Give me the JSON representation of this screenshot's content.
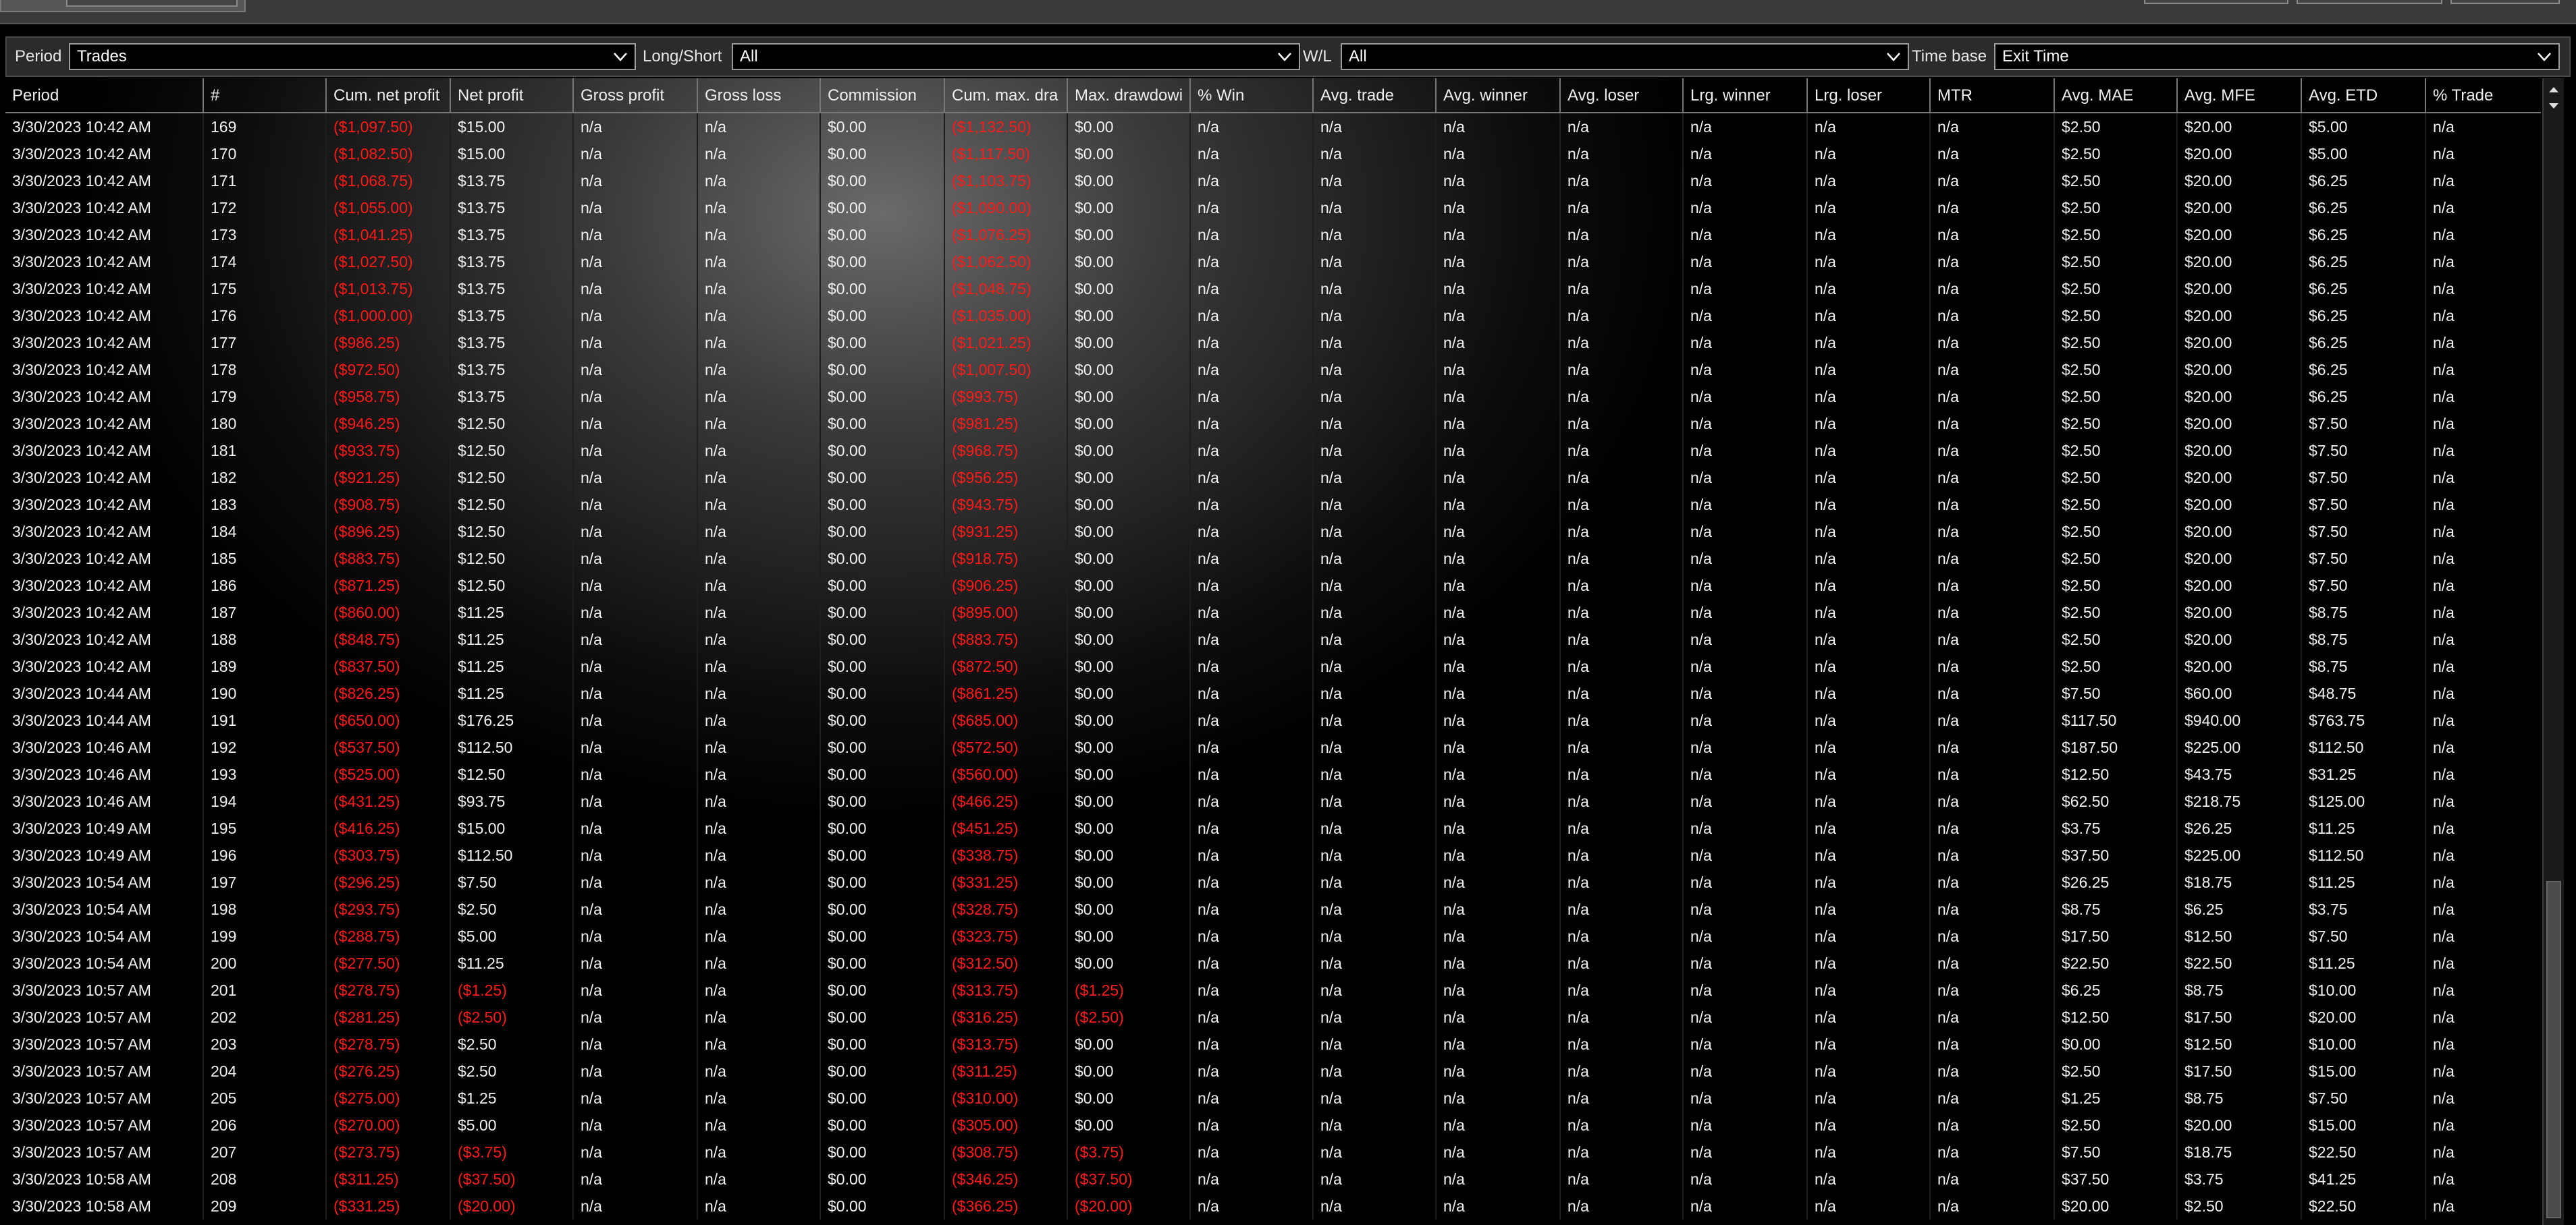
{
  "colors": {
    "negative": "#ff1a1a",
    "text": "#f2f2f2",
    "background": "#000000"
  },
  "filters": {
    "period_label": "Period",
    "period_value": "Trades",
    "longshort_label": "Long/Short",
    "longshort_value": "All",
    "wl_label": "W/L",
    "wl_value": "All",
    "timebase_label": "Time base",
    "timebase_value": "Exit Time"
  },
  "columns": [
    "Period",
    "#",
    "Cum. net profit",
    "Net profit",
    "Gross profit",
    "Gross loss",
    "Commission",
    "Cum. max. dra",
    "Max. drawdowi",
    "% Win",
    "Avg. trade",
    "Avg. winner",
    "Avg. loser",
    "Lrg. winner",
    "Lrg. loser",
    "MTR",
    "Avg. MAE",
    "Avg. MFE",
    "Avg. ETD",
    "% Trade"
  ],
  "rows": [
    [
      "3/30/2023 10:42 AM",
      "169",
      "($1,097.50)",
      "$15.00",
      "n/a",
      "n/a",
      "$0.00",
      "($1,132.50)",
      "$0.00",
      "n/a",
      "n/a",
      "n/a",
      "n/a",
      "n/a",
      "n/a",
      "n/a",
      "$2.50",
      "$20.00",
      "$5.00",
      "n/a"
    ],
    [
      "3/30/2023 10:42 AM",
      "170",
      "($1,082.50)",
      "$15.00",
      "n/a",
      "n/a",
      "$0.00",
      "($1,117.50)",
      "$0.00",
      "n/a",
      "n/a",
      "n/a",
      "n/a",
      "n/a",
      "n/a",
      "n/a",
      "$2.50",
      "$20.00",
      "$5.00",
      "n/a"
    ],
    [
      "3/30/2023 10:42 AM",
      "171",
      "($1,068.75)",
      "$13.75",
      "n/a",
      "n/a",
      "$0.00",
      "($1,103.75)",
      "$0.00",
      "n/a",
      "n/a",
      "n/a",
      "n/a",
      "n/a",
      "n/a",
      "n/a",
      "$2.50",
      "$20.00",
      "$6.25",
      "n/a"
    ],
    [
      "3/30/2023 10:42 AM",
      "172",
      "($1,055.00)",
      "$13.75",
      "n/a",
      "n/a",
      "$0.00",
      "($1,090.00)",
      "$0.00",
      "n/a",
      "n/a",
      "n/a",
      "n/a",
      "n/a",
      "n/a",
      "n/a",
      "$2.50",
      "$20.00",
      "$6.25",
      "n/a"
    ],
    [
      "3/30/2023 10:42 AM",
      "173",
      "($1,041.25)",
      "$13.75",
      "n/a",
      "n/a",
      "$0.00",
      "($1,076.25)",
      "$0.00",
      "n/a",
      "n/a",
      "n/a",
      "n/a",
      "n/a",
      "n/a",
      "n/a",
      "$2.50",
      "$20.00",
      "$6.25",
      "n/a"
    ],
    [
      "3/30/2023 10:42 AM",
      "174",
      "($1,027.50)",
      "$13.75",
      "n/a",
      "n/a",
      "$0.00",
      "($1,062.50)",
      "$0.00",
      "n/a",
      "n/a",
      "n/a",
      "n/a",
      "n/a",
      "n/a",
      "n/a",
      "$2.50",
      "$20.00",
      "$6.25",
      "n/a"
    ],
    [
      "3/30/2023 10:42 AM",
      "175",
      "($1,013.75)",
      "$13.75",
      "n/a",
      "n/a",
      "$0.00",
      "($1,048.75)",
      "$0.00",
      "n/a",
      "n/a",
      "n/a",
      "n/a",
      "n/a",
      "n/a",
      "n/a",
      "$2.50",
      "$20.00",
      "$6.25",
      "n/a"
    ],
    [
      "3/30/2023 10:42 AM",
      "176",
      "($1,000.00)",
      "$13.75",
      "n/a",
      "n/a",
      "$0.00",
      "($1,035.00)",
      "$0.00",
      "n/a",
      "n/a",
      "n/a",
      "n/a",
      "n/a",
      "n/a",
      "n/a",
      "$2.50",
      "$20.00",
      "$6.25",
      "n/a"
    ],
    [
      "3/30/2023 10:42 AM",
      "177",
      "($986.25)",
      "$13.75",
      "n/a",
      "n/a",
      "$0.00",
      "($1,021.25)",
      "$0.00",
      "n/a",
      "n/a",
      "n/a",
      "n/a",
      "n/a",
      "n/a",
      "n/a",
      "$2.50",
      "$20.00",
      "$6.25",
      "n/a"
    ],
    [
      "3/30/2023 10:42 AM",
      "178",
      "($972.50)",
      "$13.75",
      "n/a",
      "n/a",
      "$0.00",
      "($1,007.50)",
      "$0.00",
      "n/a",
      "n/a",
      "n/a",
      "n/a",
      "n/a",
      "n/a",
      "n/a",
      "$2.50",
      "$20.00",
      "$6.25",
      "n/a"
    ],
    [
      "3/30/2023 10:42 AM",
      "179",
      "($958.75)",
      "$13.75",
      "n/a",
      "n/a",
      "$0.00",
      "($993.75)",
      "$0.00",
      "n/a",
      "n/a",
      "n/a",
      "n/a",
      "n/a",
      "n/a",
      "n/a",
      "$2.50",
      "$20.00",
      "$6.25",
      "n/a"
    ],
    [
      "3/30/2023 10:42 AM",
      "180",
      "($946.25)",
      "$12.50",
      "n/a",
      "n/a",
      "$0.00",
      "($981.25)",
      "$0.00",
      "n/a",
      "n/a",
      "n/a",
      "n/a",
      "n/a",
      "n/a",
      "n/a",
      "$2.50",
      "$20.00",
      "$7.50",
      "n/a"
    ],
    [
      "3/30/2023 10:42 AM",
      "181",
      "($933.75)",
      "$12.50",
      "n/a",
      "n/a",
      "$0.00",
      "($968.75)",
      "$0.00",
      "n/a",
      "n/a",
      "n/a",
      "n/a",
      "n/a",
      "n/a",
      "n/a",
      "$2.50",
      "$20.00",
      "$7.50",
      "n/a"
    ],
    [
      "3/30/2023 10:42 AM",
      "182",
      "($921.25)",
      "$12.50",
      "n/a",
      "n/a",
      "$0.00",
      "($956.25)",
      "$0.00",
      "n/a",
      "n/a",
      "n/a",
      "n/a",
      "n/a",
      "n/a",
      "n/a",
      "$2.50",
      "$20.00",
      "$7.50",
      "n/a"
    ],
    [
      "3/30/2023 10:42 AM",
      "183",
      "($908.75)",
      "$12.50",
      "n/a",
      "n/a",
      "$0.00",
      "($943.75)",
      "$0.00",
      "n/a",
      "n/a",
      "n/a",
      "n/a",
      "n/a",
      "n/a",
      "n/a",
      "$2.50",
      "$20.00",
      "$7.50",
      "n/a"
    ],
    [
      "3/30/2023 10:42 AM",
      "184",
      "($896.25)",
      "$12.50",
      "n/a",
      "n/a",
      "$0.00",
      "($931.25)",
      "$0.00",
      "n/a",
      "n/a",
      "n/a",
      "n/a",
      "n/a",
      "n/a",
      "n/a",
      "$2.50",
      "$20.00",
      "$7.50",
      "n/a"
    ],
    [
      "3/30/2023 10:42 AM",
      "185",
      "($883.75)",
      "$12.50",
      "n/a",
      "n/a",
      "$0.00",
      "($918.75)",
      "$0.00",
      "n/a",
      "n/a",
      "n/a",
      "n/a",
      "n/a",
      "n/a",
      "n/a",
      "$2.50",
      "$20.00",
      "$7.50",
      "n/a"
    ],
    [
      "3/30/2023 10:42 AM",
      "186",
      "($871.25)",
      "$12.50",
      "n/a",
      "n/a",
      "$0.00",
      "($906.25)",
      "$0.00",
      "n/a",
      "n/a",
      "n/a",
      "n/a",
      "n/a",
      "n/a",
      "n/a",
      "$2.50",
      "$20.00",
      "$7.50",
      "n/a"
    ],
    [
      "3/30/2023 10:42 AM",
      "187",
      "($860.00)",
      "$11.25",
      "n/a",
      "n/a",
      "$0.00",
      "($895.00)",
      "$0.00",
      "n/a",
      "n/a",
      "n/a",
      "n/a",
      "n/a",
      "n/a",
      "n/a",
      "$2.50",
      "$20.00",
      "$8.75",
      "n/a"
    ],
    [
      "3/30/2023 10:42 AM",
      "188",
      "($848.75)",
      "$11.25",
      "n/a",
      "n/a",
      "$0.00",
      "($883.75)",
      "$0.00",
      "n/a",
      "n/a",
      "n/a",
      "n/a",
      "n/a",
      "n/a",
      "n/a",
      "$2.50",
      "$20.00",
      "$8.75",
      "n/a"
    ],
    [
      "3/30/2023 10:42 AM",
      "189",
      "($837.50)",
      "$11.25",
      "n/a",
      "n/a",
      "$0.00",
      "($872.50)",
      "$0.00",
      "n/a",
      "n/a",
      "n/a",
      "n/a",
      "n/a",
      "n/a",
      "n/a",
      "$2.50",
      "$20.00",
      "$8.75",
      "n/a"
    ],
    [
      "3/30/2023 10:44 AM",
      "190",
      "($826.25)",
      "$11.25",
      "n/a",
      "n/a",
      "$0.00",
      "($861.25)",
      "$0.00",
      "n/a",
      "n/a",
      "n/a",
      "n/a",
      "n/a",
      "n/a",
      "n/a",
      "$7.50",
      "$60.00",
      "$48.75",
      "n/a"
    ],
    [
      "3/30/2023 10:44 AM",
      "191",
      "($650.00)",
      "$176.25",
      "n/a",
      "n/a",
      "$0.00",
      "($685.00)",
      "$0.00",
      "n/a",
      "n/a",
      "n/a",
      "n/a",
      "n/a",
      "n/a",
      "n/a",
      "$117.50",
      "$940.00",
      "$763.75",
      "n/a"
    ],
    [
      "3/30/2023 10:46 AM",
      "192",
      "($537.50)",
      "$112.50",
      "n/a",
      "n/a",
      "$0.00",
      "($572.50)",
      "$0.00",
      "n/a",
      "n/a",
      "n/a",
      "n/a",
      "n/a",
      "n/a",
      "n/a",
      "$187.50",
      "$225.00",
      "$112.50",
      "n/a"
    ],
    [
      "3/30/2023 10:46 AM",
      "193",
      "($525.00)",
      "$12.50",
      "n/a",
      "n/a",
      "$0.00",
      "($560.00)",
      "$0.00",
      "n/a",
      "n/a",
      "n/a",
      "n/a",
      "n/a",
      "n/a",
      "n/a",
      "$12.50",
      "$43.75",
      "$31.25",
      "n/a"
    ],
    [
      "3/30/2023 10:46 AM",
      "194",
      "($431.25)",
      "$93.75",
      "n/a",
      "n/a",
      "$0.00",
      "($466.25)",
      "$0.00",
      "n/a",
      "n/a",
      "n/a",
      "n/a",
      "n/a",
      "n/a",
      "n/a",
      "$62.50",
      "$218.75",
      "$125.00",
      "n/a"
    ],
    [
      "3/30/2023 10:49 AM",
      "195",
      "($416.25)",
      "$15.00",
      "n/a",
      "n/a",
      "$0.00",
      "($451.25)",
      "$0.00",
      "n/a",
      "n/a",
      "n/a",
      "n/a",
      "n/a",
      "n/a",
      "n/a",
      "$3.75",
      "$26.25",
      "$11.25",
      "n/a"
    ],
    [
      "3/30/2023 10:49 AM",
      "196",
      "($303.75)",
      "$112.50",
      "n/a",
      "n/a",
      "$0.00",
      "($338.75)",
      "$0.00",
      "n/a",
      "n/a",
      "n/a",
      "n/a",
      "n/a",
      "n/a",
      "n/a",
      "$37.50",
      "$225.00",
      "$112.50",
      "n/a"
    ],
    [
      "3/30/2023 10:54 AM",
      "197",
      "($296.25)",
      "$7.50",
      "n/a",
      "n/a",
      "$0.00",
      "($331.25)",
      "$0.00",
      "n/a",
      "n/a",
      "n/a",
      "n/a",
      "n/a",
      "n/a",
      "n/a",
      "$26.25",
      "$18.75",
      "$11.25",
      "n/a"
    ],
    [
      "3/30/2023 10:54 AM",
      "198",
      "($293.75)",
      "$2.50",
      "n/a",
      "n/a",
      "$0.00",
      "($328.75)",
      "$0.00",
      "n/a",
      "n/a",
      "n/a",
      "n/a",
      "n/a",
      "n/a",
      "n/a",
      "$8.75",
      "$6.25",
      "$3.75",
      "n/a"
    ],
    [
      "3/30/2023 10:54 AM",
      "199",
      "($288.75)",
      "$5.00",
      "n/a",
      "n/a",
      "$0.00",
      "($323.75)",
      "$0.00",
      "n/a",
      "n/a",
      "n/a",
      "n/a",
      "n/a",
      "n/a",
      "n/a",
      "$17.50",
      "$12.50",
      "$7.50",
      "n/a"
    ],
    [
      "3/30/2023 10:54 AM",
      "200",
      "($277.50)",
      "$11.25",
      "n/a",
      "n/a",
      "$0.00",
      "($312.50)",
      "$0.00",
      "n/a",
      "n/a",
      "n/a",
      "n/a",
      "n/a",
      "n/a",
      "n/a",
      "$22.50",
      "$22.50",
      "$11.25",
      "n/a"
    ],
    [
      "3/30/2023 10:57 AM",
      "201",
      "($278.75)",
      "($1.25)",
      "n/a",
      "n/a",
      "$0.00",
      "($313.75)",
      "($1.25)",
      "n/a",
      "n/a",
      "n/a",
      "n/a",
      "n/a",
      "n/a",
      "n/a",
      "$6.25",
      "$8.75",
      "$10.00",
      "n/a"
    ],
    [
      "3/30/2023 10:57 AM",
      "202",
      "($281.25)",
      "($2.50)",
      "n/a",
      "n/a",
      "$0.00",
      "($316.25)",
      "($2.50)",
      "n/a",
      "n/a",
      "n/a",
      "n/a",
      "n/a",
      "n/a",
      "n/a",
      "$12.50",
      "$17.50",
      "$20.00",
      "n/a"
    ],
    [
      "3/30/2023 10:57 AM",
      "203",
      "($278.75)",
      "$2.50",
      "n/a",
      "n/a",
      "$0.00",
      "($313.75)",
      "$0.00",
      "n/a",
      "n/a",
      "n/a",
      "n/a",
      "n/a",
      "n/a",
      "n/a",
      "$0.00",
      "$12.50",
      "$10.00",
      "n/a"
    ],
    [
      "3/30/2023 10:57 AM",
      "204",
      "($276.25)",
      "$2.50",
      "n/a",
      "n/a",
      "$0.00",
      "($311.25)",
      "$0.00",
      "n/a",
      "n/a",
      "n/a",
      "n/a",
      "n/a",
      "n/a",
      "n/a",
      "$2.50",
      "$17.50",
      "$15.00",
      "n/a"
    ],
    [
      "3/30/2023 10:57 AM",
      "205",
      "($275.00)",
      "$1.25",
      "n/a",
      "n/a",
      "$0.00",
      "($310.00)",
      "$0.00",
      "n/a",
      "n/a",
      "n/a",
      "n/a",
      "n/a",
      "n/a",
      "n/a",
      "$1.25",
      "$8.75",
      "$7.50",
      "n/a"
    ],
    [
      "3/30/2023 10:57 AM",
      "206",
      "($270.00)",
      "$5.00",
      "n/a",
      "n/a",
      "$0.00",
      "($305.00)",
      "$0.00",
      "n/a",
      "n/a",
      "n/a",
      "n/a",
      "n/a",
      "n/a",
      "n/a",
      "$2.50",
      "$20.00",
      "$15.00",
      "n/a"
    ],
    [
      "3/30/2023 10:57 AM",
      "207",
      "($273.75)",
      "($3.75)",
      "n/a",
      "n/a",
      "$0.00",
      "($308.75)",
      "($3.75)",
      "n/a",
      "n/a",
      "n/a",
      "n/a",
      "n/a",
      "n/a",
      "n/a",
      "$7.50",
      "$18.75",
      "$22.50",
      "n/a"
    ],
    [
      "3/30/2023 10:58 AM",
      "208",
      "($311.25)",
      "($37.50)",
      "n/a",
      "n/a",
      "$0.00",
      "($346.25)",
      "($37.50)",
      "n/a",
      "n/a",
      "n/a",
      "n/a",
      "n/a",
      "n/a",
      "n/a",
      "$37.50",
      "$3.75",
      "$41.25",
      "n/a"
    ],
    [
      "3/30/2023 10:58 AM",
      "209",
      "($331.25)",
      "($20.00)",
      "n/a",
      "n/a",
      "$0.00",
      "($366.25)",
      "($20.00)",
      "n/a",
      "n/a",
      "n/a",
      "n/a",
      "n/a",
      "n/a",
      "n/a",
      "$20.00",
      "$2.50",
      "$22.50",
      "n/a"
    ]
  ]
}
